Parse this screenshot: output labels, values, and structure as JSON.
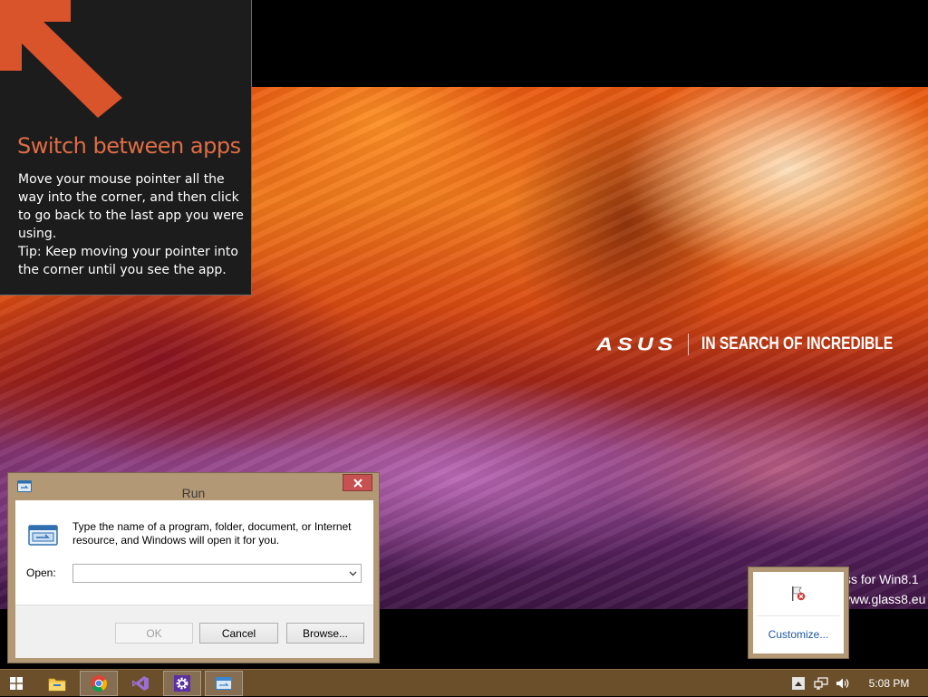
{
  "wallpaper": {
    "brand_logo": "ASUS",
    "tagline": "IN SEARCH OF INCREDIBLE",
    "watermark_line1": "ss for Win8.1",
    "watermark_line2": "www.glass8.eu"
  },
  "hint": {
    "title": "Switch between apps",
    "body": "Move your mouse pointer all the way into the corner, and then click to go back to the last app you were using.",
    "tip": "Tip: Keep moving your pointer into the corner until you see the app.",
    "title_color": "#de6d45",
    "arrow_color": "#d9532b",
    "arrow_icon": "arrow-up-left-icon"
  },
  "run_dialog": {
    "title": "Run",
    "description": "Type the name of a program, folder, document, or Internet resource, and Windows will open it for you.",
    "open_label": "Open:",
    "open_value": "",
    "ok_label": "OK",
    "cancel_label": "Cancel",
    "browse_label": "Browse...",
    "close_icon": "close-icon",
    "app_icon": "run-icon"
  },
  "tray_popup": {
    "customize_label": "Customize...",
    "icon": "action-center-flag-icon"
  },
  "taskbar": {
    "start_icon": "windows-logo-icon",
    "apps": [
      {
        "name": "file-explorer",
        "icon": "folder-icon",
        "active": false
      },
      {
        "name": "google-chrome",
        "icon": "chrome-icon",
        "active": true
      },
      {
        "name": "visual-studio",
        "icon": "visual-studio-icon",
        "active": false
      },
      {
        "name": "settings",
        "icon": "gear-icon",
        "active": true
      },
      {
        "name": "run",
        "icon": "run-icon",
        "active": true
      }
    ],
    "tray_icons": [
      "show-hidden-icons-icon",
      "network-icon",
      "volume-icon"
    ],
    "clock": "5:08 PM",
    "color": "#6b4f2b",
    "accent": "#b29874"
  }
}
